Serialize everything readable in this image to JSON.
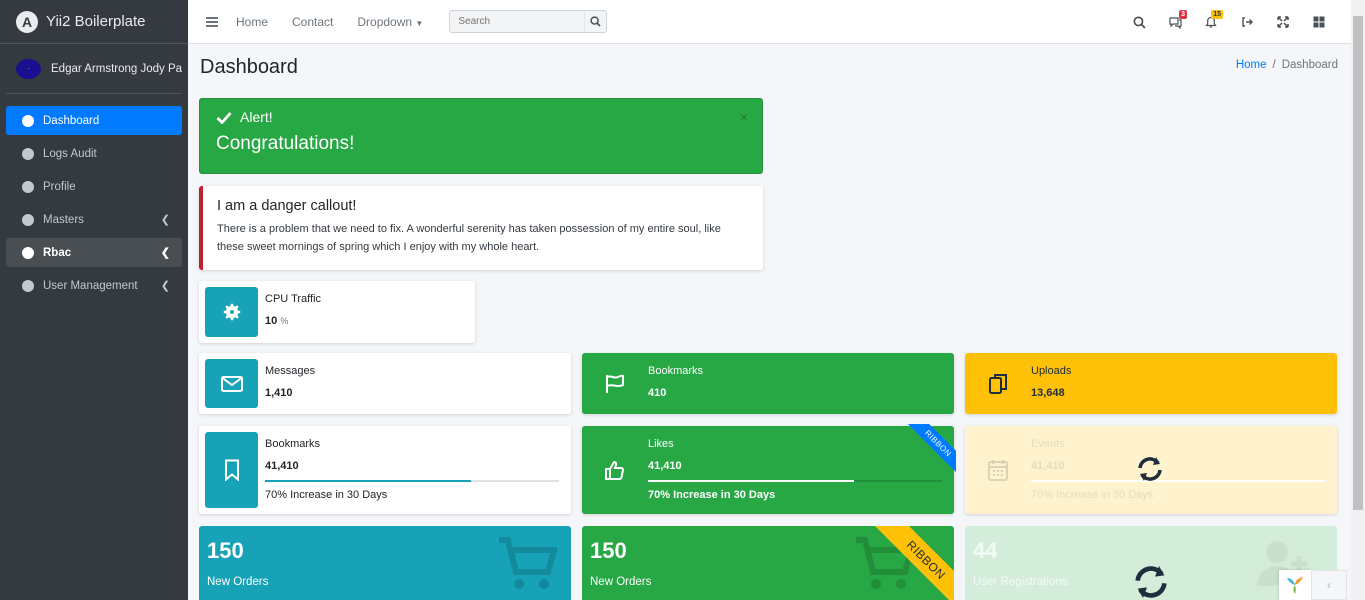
{
  "brand": {
    "name": "Yii2 Boilerplate"
  },
  "user": {
    "name": "Edgar Armstrong Jody Paris"
  },
  "sidebar": {
    "items": [
      {
        "label": "Dashboard"
      },
      {
        "label": "Logs Audit"
      },
      {
        "label": "Profile"
      },
      {
        "label": "Masters"
      },
      {
        "label": "Rbac"
      },
      {
        "label": "User Management"
      }
    ]
  },
  "topbar": {
    "links": [
      "Home",
      "Contact",
      "Dropdown"
    ],
    "search_placeholder": "Search",
    "messages_badge": "3",
    "notifications_badge": "15"
  },
  "page": {
    "title": "Dashboard",
    "breadcrumb": {
      "home": "Home",
      "current": "Dashboard"
    }
  },
  "alert": {
    "title": "Alert!",
    "message": "Congratulations!",
    "close": "×"
  },
  "callout": {
    "title": "I am a danger callout!",
    "text": "There is a problem that we need to fix. A wonderful serenity has taken possession of my entire soul, like these sweet mornings of spring which I enjoy with my whole heart."
  },
  "cpu": {
    "label": "CPU Traffic",
    "value": "10",
    "unit": "%"
  },
  "info_row1": [
    {
      "label": "Messages",
      "value": "1,410"
    },
    {
      "label": "Bookmarks",
      "value": "410"
    },
    {
      "label": "Uploads",
      "value": "13,648"
    }
  ],
  "info_row2": [
    {
      "label": "Bookmarks",
      "value": "41,410",
      "desc": "70% Increase in 30 Days",
      "progress": 0.7
    },
    {
      "label": "Likes",
      "value": "41,410",
      "desc": "70% Increase in 30 Days",
      "progress": 0.7,
      "ribbon": "RIBBON"
    },
    {
      "label": "Events",
      "value": "41,410",
      "desc": "70% Increase in 30 Days",
      "progress": 0.7
    }
  ],
  "small_boxes": [
    {
      "number": "150",
      "label": "New Orders"
    },
    {
      "number": "150",
      "label": "New Orders",
      "ribbon": "RIBBON"
    },
    {
      "number": "44",
      "label": "User Registrations"
    }
  ],
  "colors": {
    "sidebar_bg": "#343a40",
    "primary": "#007bff",
    "success": "#28a745",
    "info": "#17a2b8",
    "warning": "#ffc107",
    "danger": "#bd2130"
  }
}
